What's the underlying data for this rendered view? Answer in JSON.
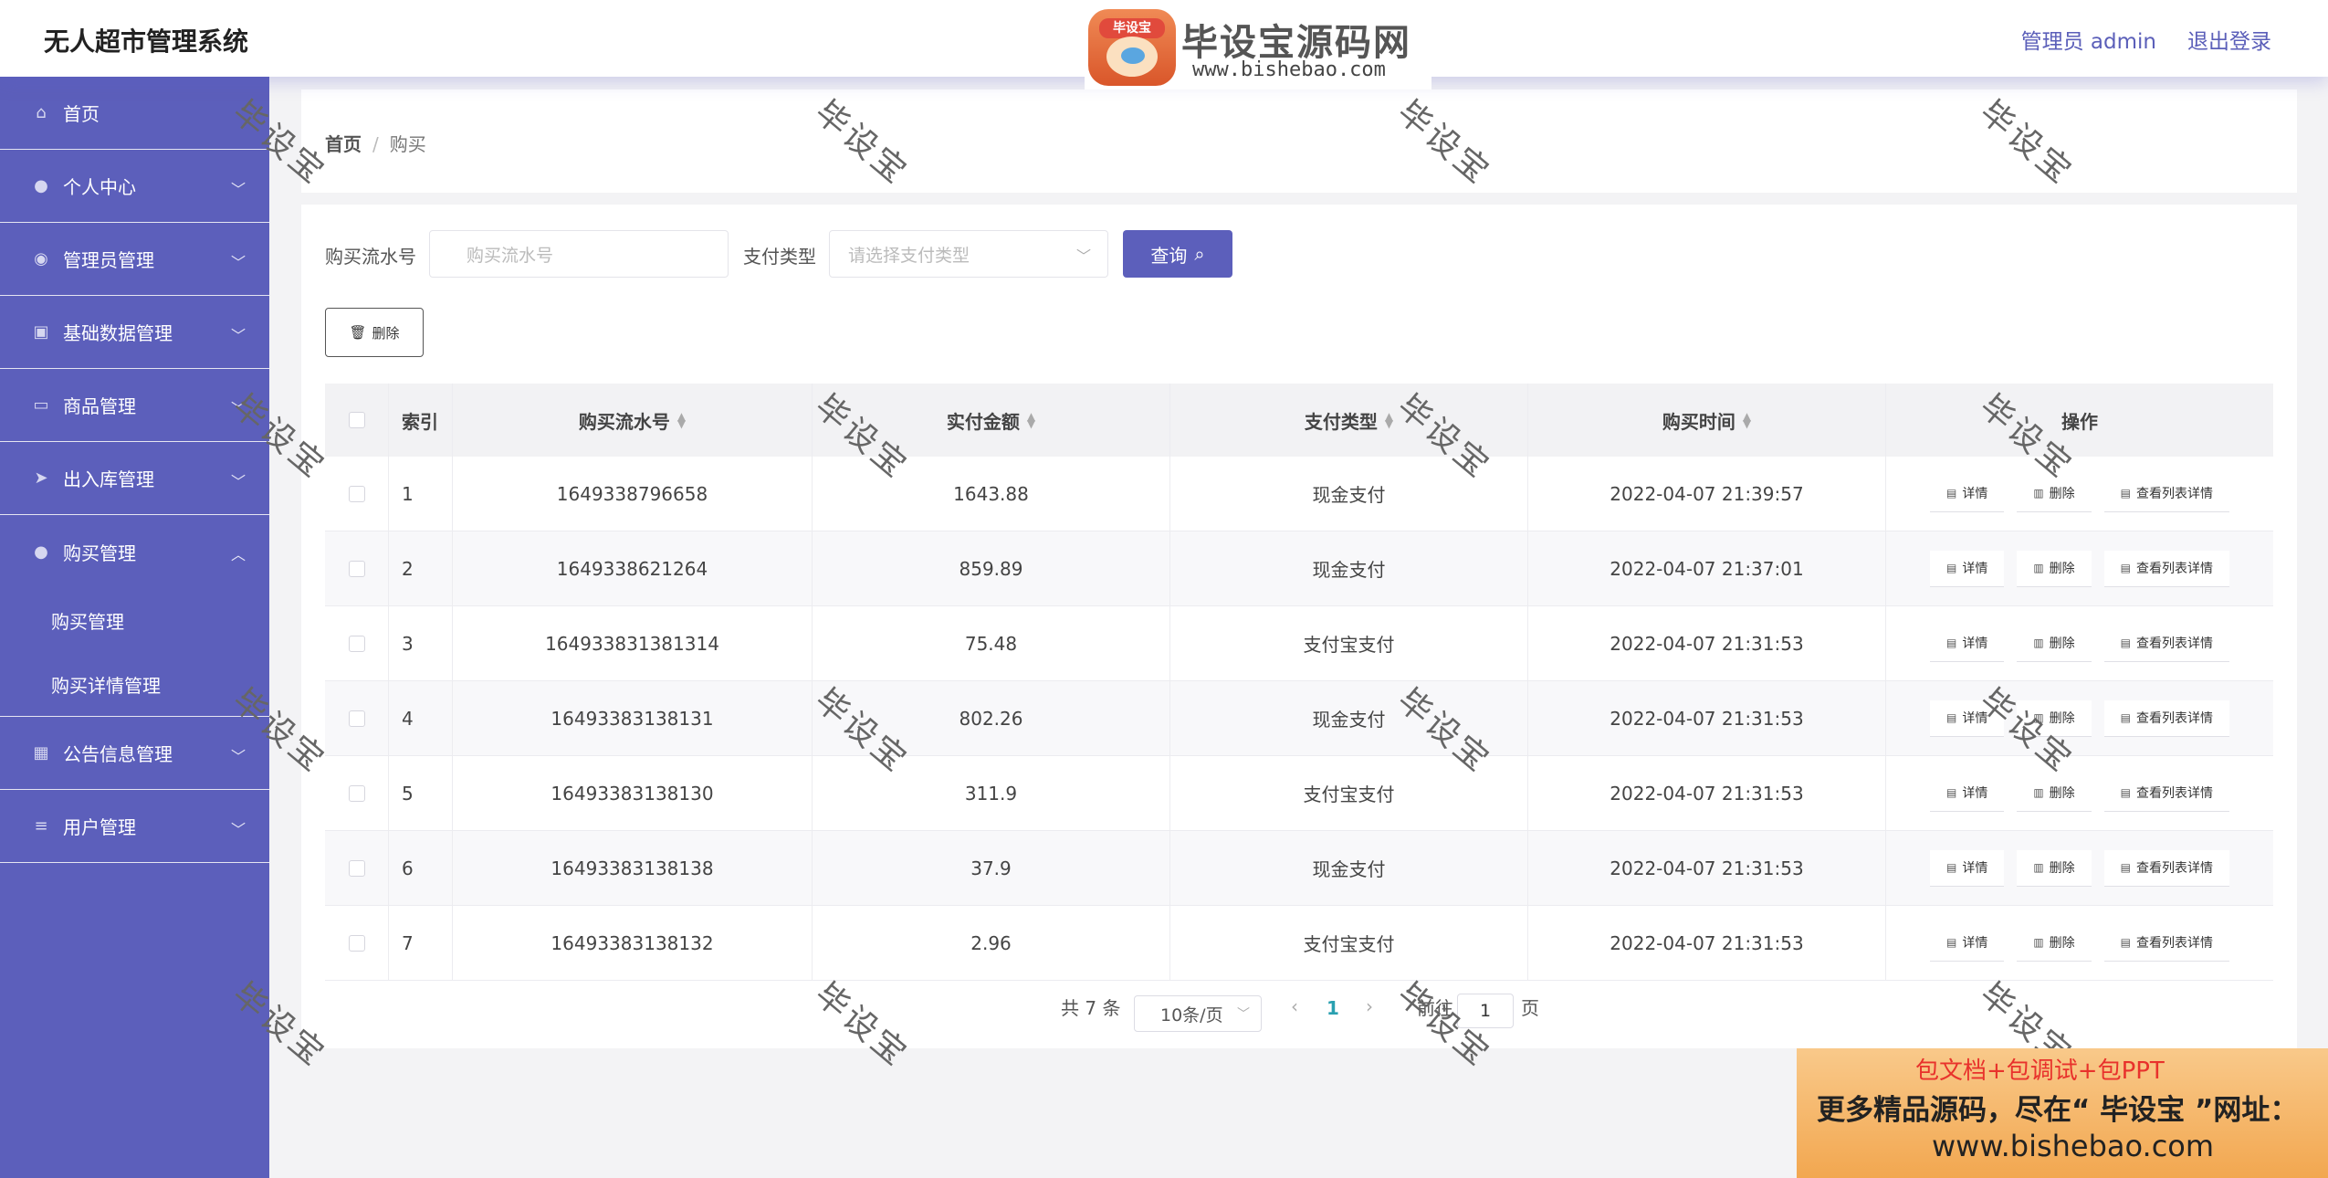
{
  "header": {
    "app_title": "无人超市管理系统",
    "user_label": "管理员 admin",
    "logout_label": "退出登录"
  },
  "brand": {
    "logo_badge": "毕设宝",
    "name": "毕设宝源码网",
    "url": "www.bishebao.com"
  },
  "sidebar": {
    "items": [
      {
        "label": "首页",
        "icon": "home-icon"
      },
      {
        "label": "个人中心",
        "icon": "user-icon"
      },
      {
        "label": "管理员管理",
        "icon": "location-icon"
      },
      {
        "label": "基础数据管理",
        "icon": "picture-icon"
      },
      {
        "label": "商品管理",
        "icon": "card-icon"
      },
      {
        "label": "出入库管理",
        "icon": "send-icon"
      },
      {
        "label": "购买管理",
        "icon": "user-solid-icon"
      },
      {
        "label": "公告信息管理",
        "icon": "grid-icon"
      },
      {
        "label": "用户管理",
        "icon": "sliders-icon"
      }
    ],
    "sub_items": [
      "购买管理",
      "购买详情管理"
    ]
  },
  "breadcrumb": {
    "home": "首页",
    "sep": "/",
    "current": "购买"
  },
  "filters": {
    "serial_label": "购买流水号",
    "serial_placeholder": "购买流水号",
    "paytype_label": "支付类型",
    "paytype_placeholder": "请选择支付类型",
    "query_label": "查询"
  },
  "toolbar": {
    "delete_label": "删除"
  },
  "table": {
    "headers": {
      "index": "索引",
      "serial": "购买流水号",
      "amount": "实付金额",
      "paytype": "支付类型",
      "time": "购买时间",
      "ops": "操作"
    },
    "op_labels": {
      "detail": "详情",
      "delete": "删除",
      "list": "查看列表详情"
    },
    "rows": [
      {
        "index": "1",
        "serial": "1649338796658",
        "amount": "1643.88",
        "paytype": "现金支付",
        "time": "2022-04-07 21:39:57"
      },
      {
        "index": "2",
        "serial": "1649338621264",
        "amount": "859.89",
        "paytype": "现金支付",
        "time": "2022-04-07 21:37:01"
      },
      {
        "index": "3",
        "serial": "164933831381314",
        "amount": "75.48",
        "paytype": "支付宝支付",
        "time": "2022-04-07 21:31:53"
      },
      {
        "index": "4",
        "serial": "16493383138131",
        "amount": "802.26",
        "paytype": "现金支付",
        "time": "2022-04-07 21:31:53"
      },
      {
        "index": "5",
        "serial": "16493383138130",
        "amount": "311.9",
        "paytype": "支付宝支付",
        "time": "2022-04-07 21:31:53"
      },
      {
        "index": "6",
        "serial": "16493383138138",
        "amount": "37.9",
        "paytype": "现金支付",
        "time": "2022-04-07 21:31:53"
      },
      {
        "index": "7",
        "serial": "16493383138132",
        "amount": "2.96",
        "paytype": "支付宝支付",
        "time": "2022-04-07 21:31:53"
      }
    ]
  },
  "pagination": {
    "total": "共 7 条",
    "page_size": "10条/页",
    "current": "1",
    "goto_label": "前往",
    "goto_value": "1",
    "page_suffix": "页"
  },
  "watermark": {
    "text": "毕设宝"
  },
  "ad": {
    "top": "包文档+包调试+包PPT",
    "mid": "更多精品源码，尽在“ 毕设宝 ”网址：",
    "url": "www.bishebao.com"
  },
  "colors": {
    "accent": "#5c5fbb",
    "page_bg": "#f3f3f5",
    "current_page": "#29a0b0"
  }
}
